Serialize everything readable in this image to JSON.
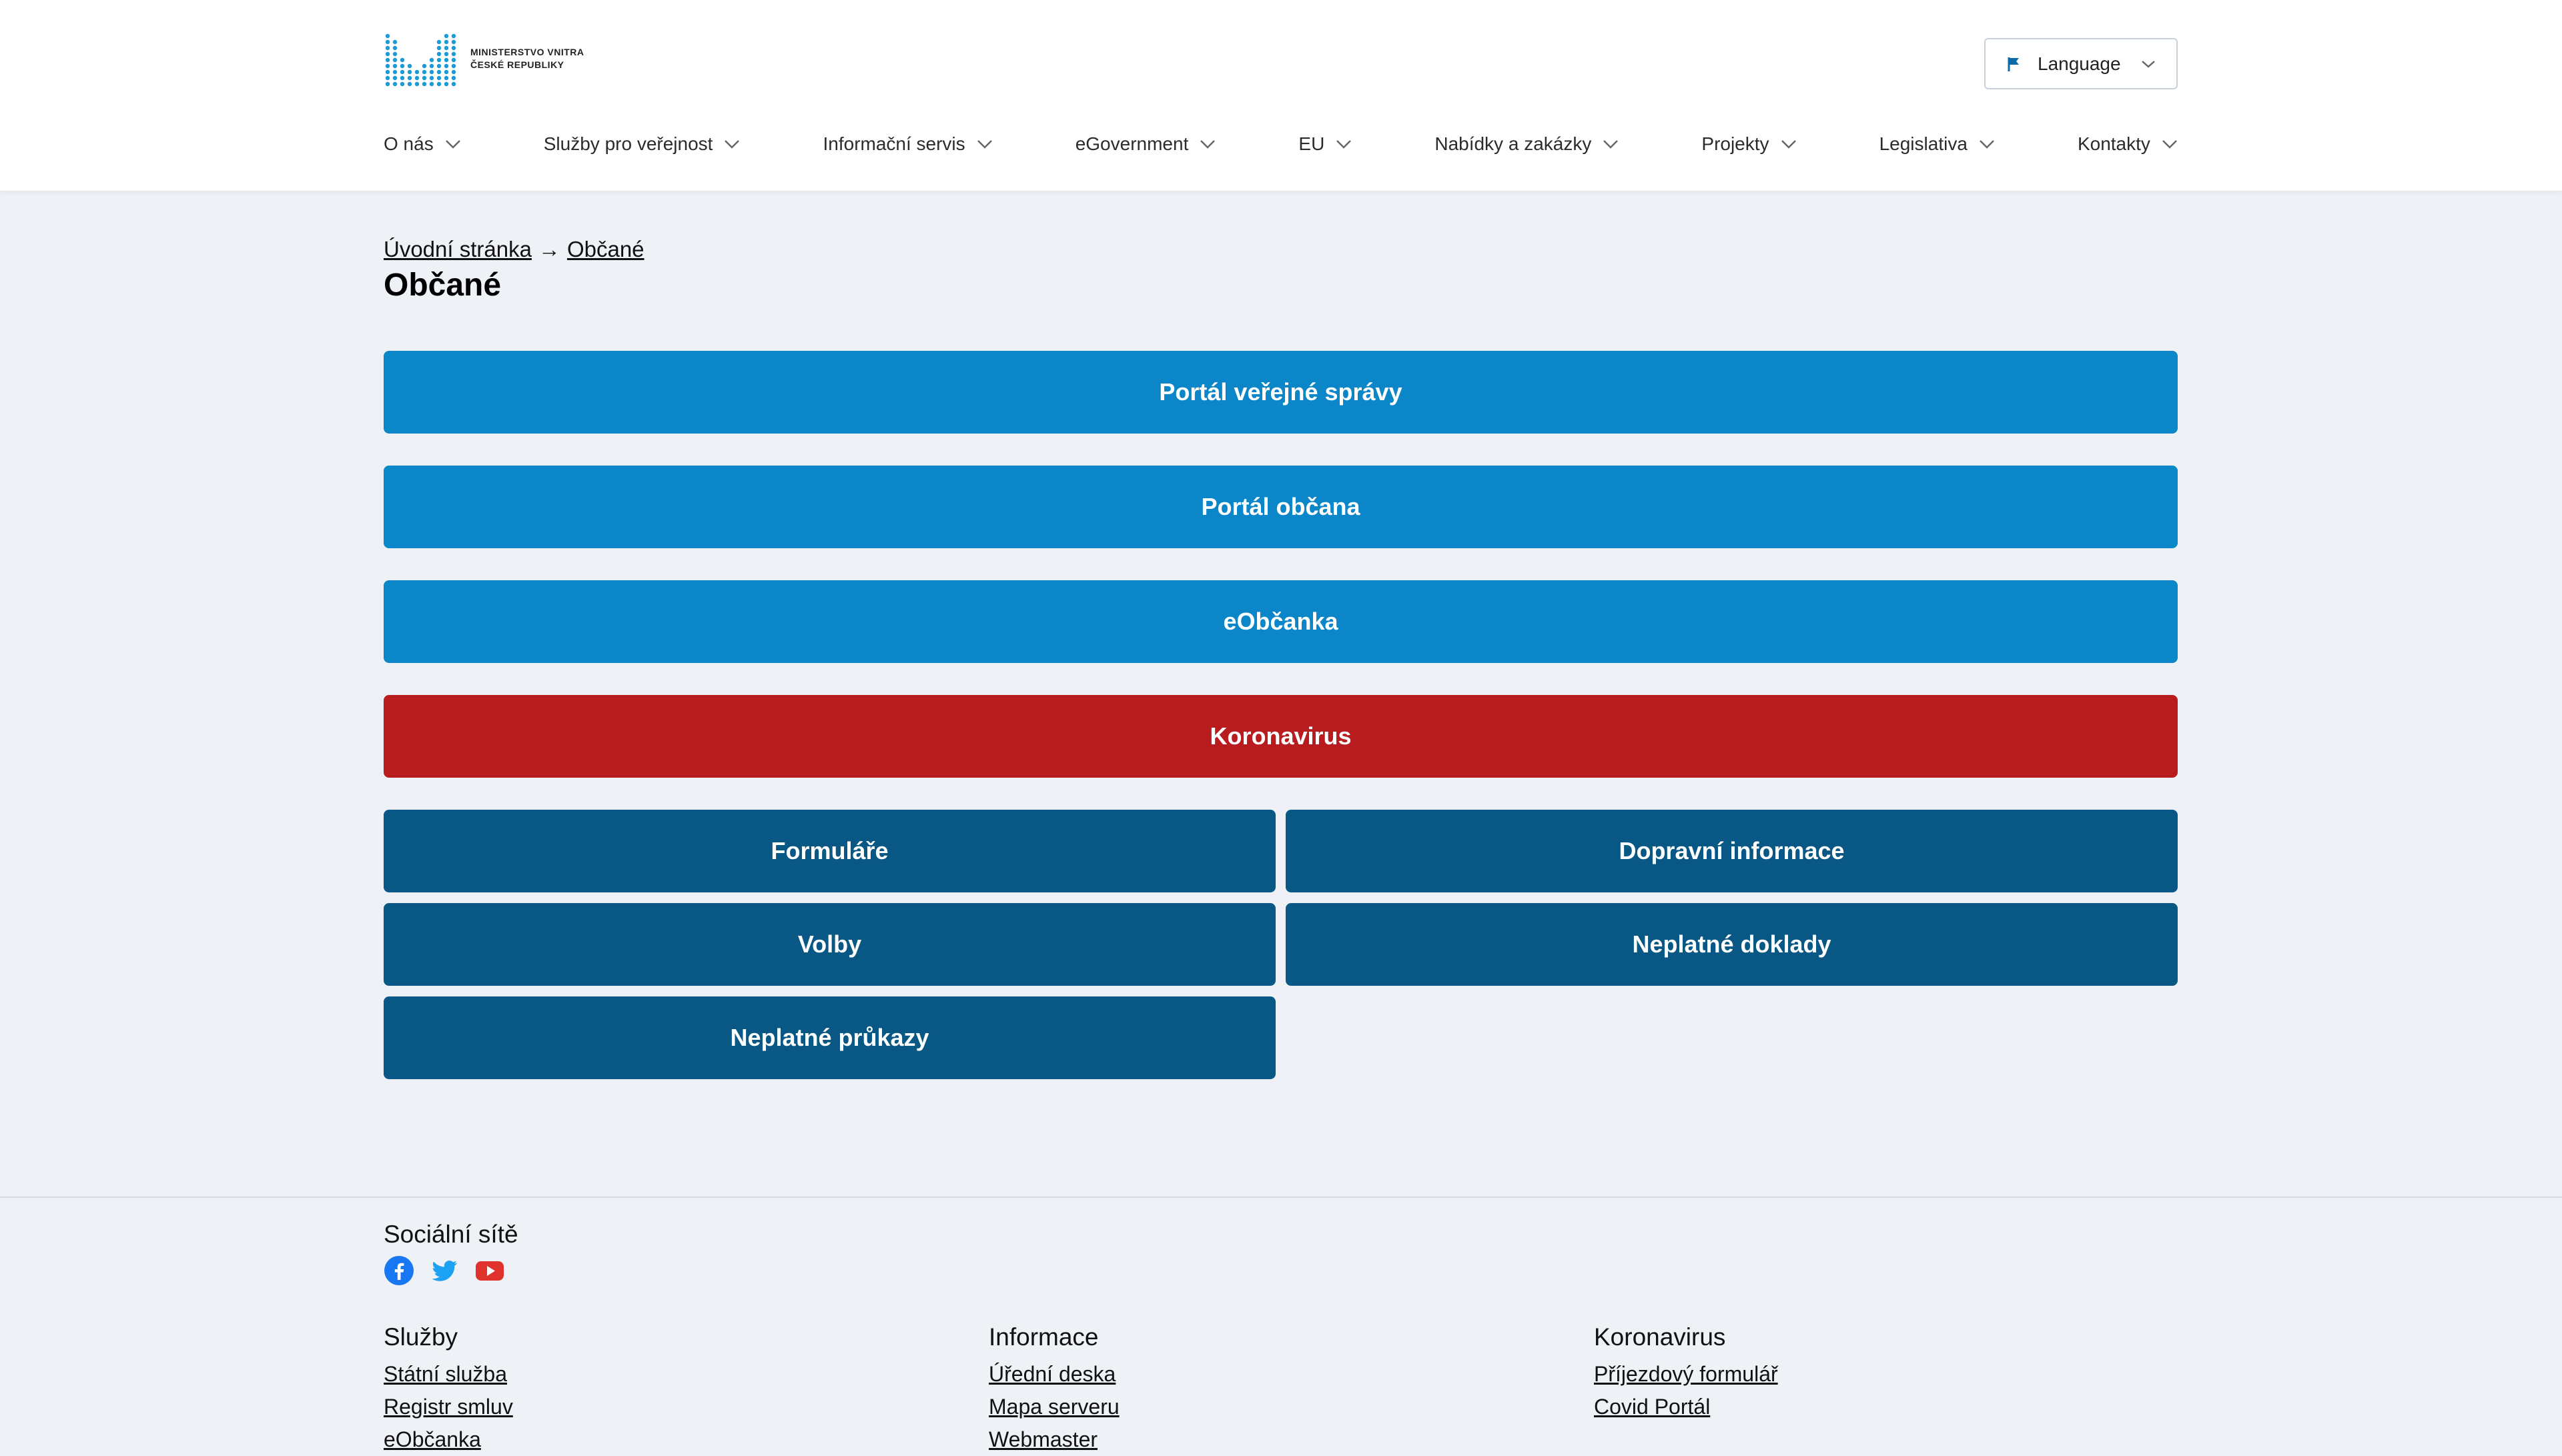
{
  "header": {
    "logo": {
      "line1": "MINISTERSTVO VNITRA",
      "line2": "ČESKÉ REPUBLIKY",
      "color": "#1b9ad6"
    },
    "language_button": {
      "label": "Language",
      "icon": "flag-icon"
    },
    "nav": [
      {
        "label": "O nás"
      },
      {
        "label": "Služby pro veřejnost"
      },
      {
        "label": "Informační servis"
      },
      {
        "label": "eGovernment"
      },
      {
        "label": "EU"
      },
      {
        "label": "Nabídky a zakázky"
      },
      {
        "label": "Projekty"
      },
      {
        "label": "Legislativa"
      },
      {
        "label": "Kontakty"
      }
    ]
  },
  "breadcrumb": {
    "home": "Úvodní stránka",
    "separator": "→",
    "current": "Občané"
  },
  "page_title": "Občané",
  "primary_links": [
    {
      "label": "Portál veřejné správy",
      "color": "#0b86c8"
    },
    {
      "label": "Portál občana",
      "color": "#0b86c8"
    },
    {
      "label": "eObčanka",
      "color": "#0b86c8"
    },
    {
      "label": "Koronavirus",
      "color": "#b91c1f"
    }
  ],
  "secondary_links": [
    {
      "label": "Formuláře"
    },
    {
      "label": "Dopravní informace"
    },
    {
      "label": "Volby"
    },
    {
      "label": "Neplatné doklady"
    },
    {
      "label": "Neplatné průkazy"
    }
  ],
  "secondary_color": "#095784",
  "footer": {
    "social_heading": "Sociální sítě",
    "social_icons": [
      "facebook-icon",
      "twitter-icon",
      "youtube-icon"
    ],
    "columns": [
      {
        "title": "Služby",
        "links": [
          "Státní služba",
          "Registr smluv",
          "eObčanka"
        ]
      },
      {
        "title": "Informace",
        "links": [
          "Úřední deska",
          "Mapa serveru",
          "Webmaster"
        ]
      },
      {
        "title": "Koronavirus",
        "links": [
          "Příjezdový formulář",
          "Covid Portál"
        ]
      }
    ]
  }
}
